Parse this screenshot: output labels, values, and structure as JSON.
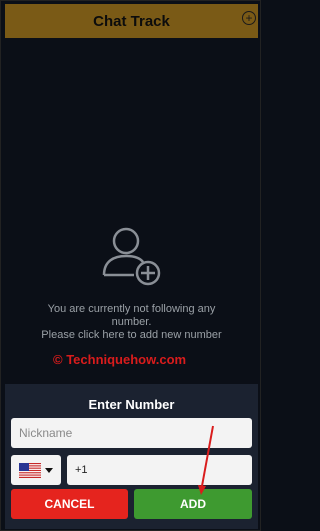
{
  "header": {
    "title": "Chat Track",
    "add_icon": "plus-circle-icon"
  },
  "empty_state": {
    "icon": "add-user-icon",
    "line1": "You are currently not following any",
    "line2": "number.",
    "line3": "Please click here to add new number"
  },
  "watermark": {
    "text": "© Techniquehow.com"
  },
  "dialog": {
    "title": "Enter Number",
    "nickname_placeholder": "Nickname",
    "country_flag": "us-flag-icon",
    "phone_value": "+1",
    "cancel_label": "CANCEL",
    "add_label": "ADD"
  },
  "colors": {
    "header_bg": "#7a5a16",
    "background": "#0b0f17",
    "sheet_bg": "#1b2230",
    "cancel_bg": "#e5241e",
    "add_bg": "#3e9a30",
    "annotation": "#d91c1c"
  }
}
